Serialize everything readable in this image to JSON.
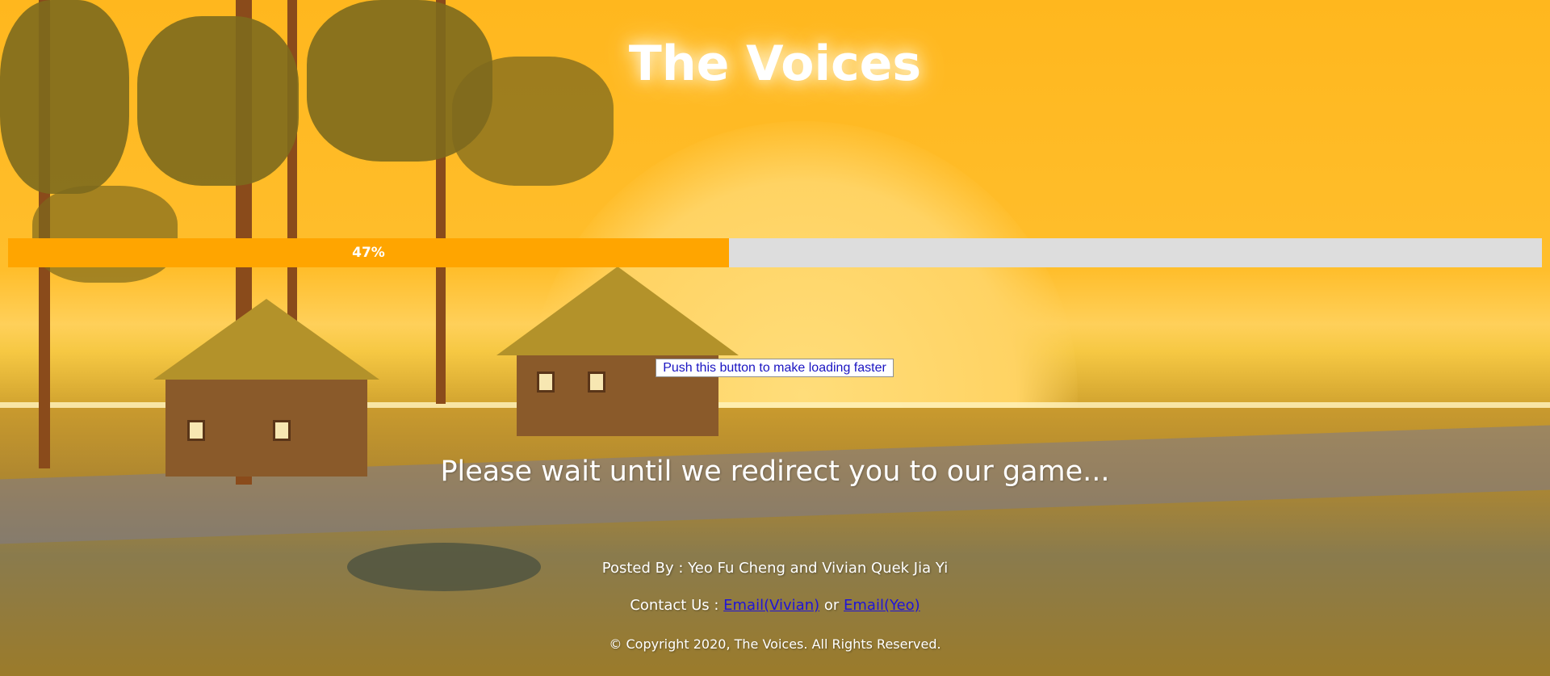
{
  "page": {
    "title": "The Voices",
    "progress": {
      "percent": 47,
      "label": "47%"
    },
    "speed_button_label": "Push this button to make loading faster",
    "wait_message": "Please wait until we redirect you to our game...",
    "footer": {
      "posted_by": "Posted By : Yeo Fu Cheng and Vivian Quek Jia Yi",
      "contact_prefix": "Contact Us : ",
      "contact_link_1": "Email(Vivian)",
      "contact_or": " or ",
      "contact_link_2": "Email(Yeo)",
      "copyright": "© Copyright 2020, The Voices. All Rights Reserved."
    },
    "colors": {
      "progress_fill": "#ffa500",
      "progress_track": "#dddddd",
      "link": "#1f14d8"
    }
  }
}
